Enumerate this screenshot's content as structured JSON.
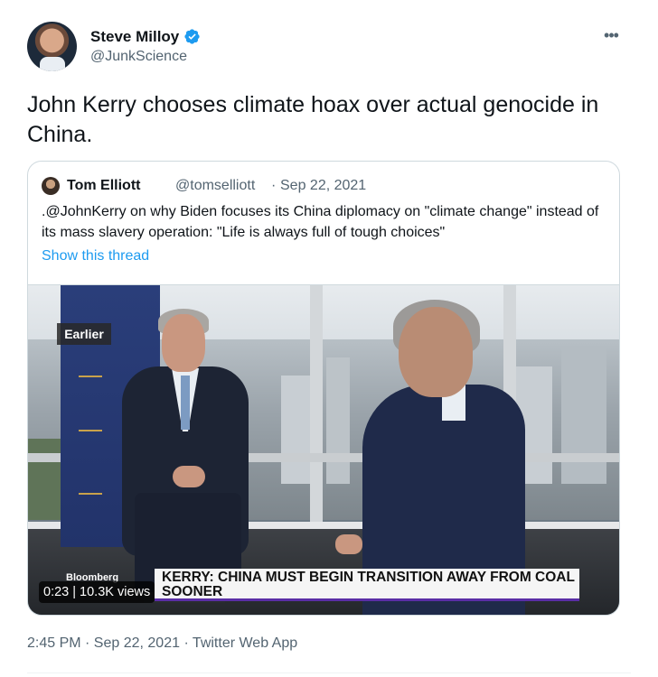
{
  "author": {
    "name": "Steve Milloy",
    "handle": "@JunkScience",
    "verified": true
  },
  "tweet": {
    "text": "John Kerry chooses climate hoax over actual genocide in China.",
    "timestamp": "2:45 PM · Sep 22, 2021 · Twitter Web App"
  },
  "quoted_tweet": {
    "name": "Tom Elliott",
    "handle": "@tomselliott",
    "separator": "·",
    "date": "Sep 22, 2021",
    "text": ".@JohnKerry on why Biden focuses its China diplomacy on \"climate change\" instead of its mass slavery operation: \"Life is always full of tough choices\"",
    "show_thread": "Show this thread"
  },
  "video": {
    "earlier_label": "Earlier",
    "network": "Bloomberg",
    "chyron": "KERRY: CHINA MUST BEGIN TRANSITION AWAY FROM COAL SOONER",
    "duration_views": "0:23 | 10.3K views"
  },
  "icons": {
    "more": "more-horizontal-icon",
    "verified": "verified-badge-icon"
  },
  "colors": {
    "text": "#0f1419",
    "secondary": "#536471",
    "link": "#1d9bf0",
    "verified": "#1d9bf0",
    "chyron_accent": "#5a2ea6"
  }
}
